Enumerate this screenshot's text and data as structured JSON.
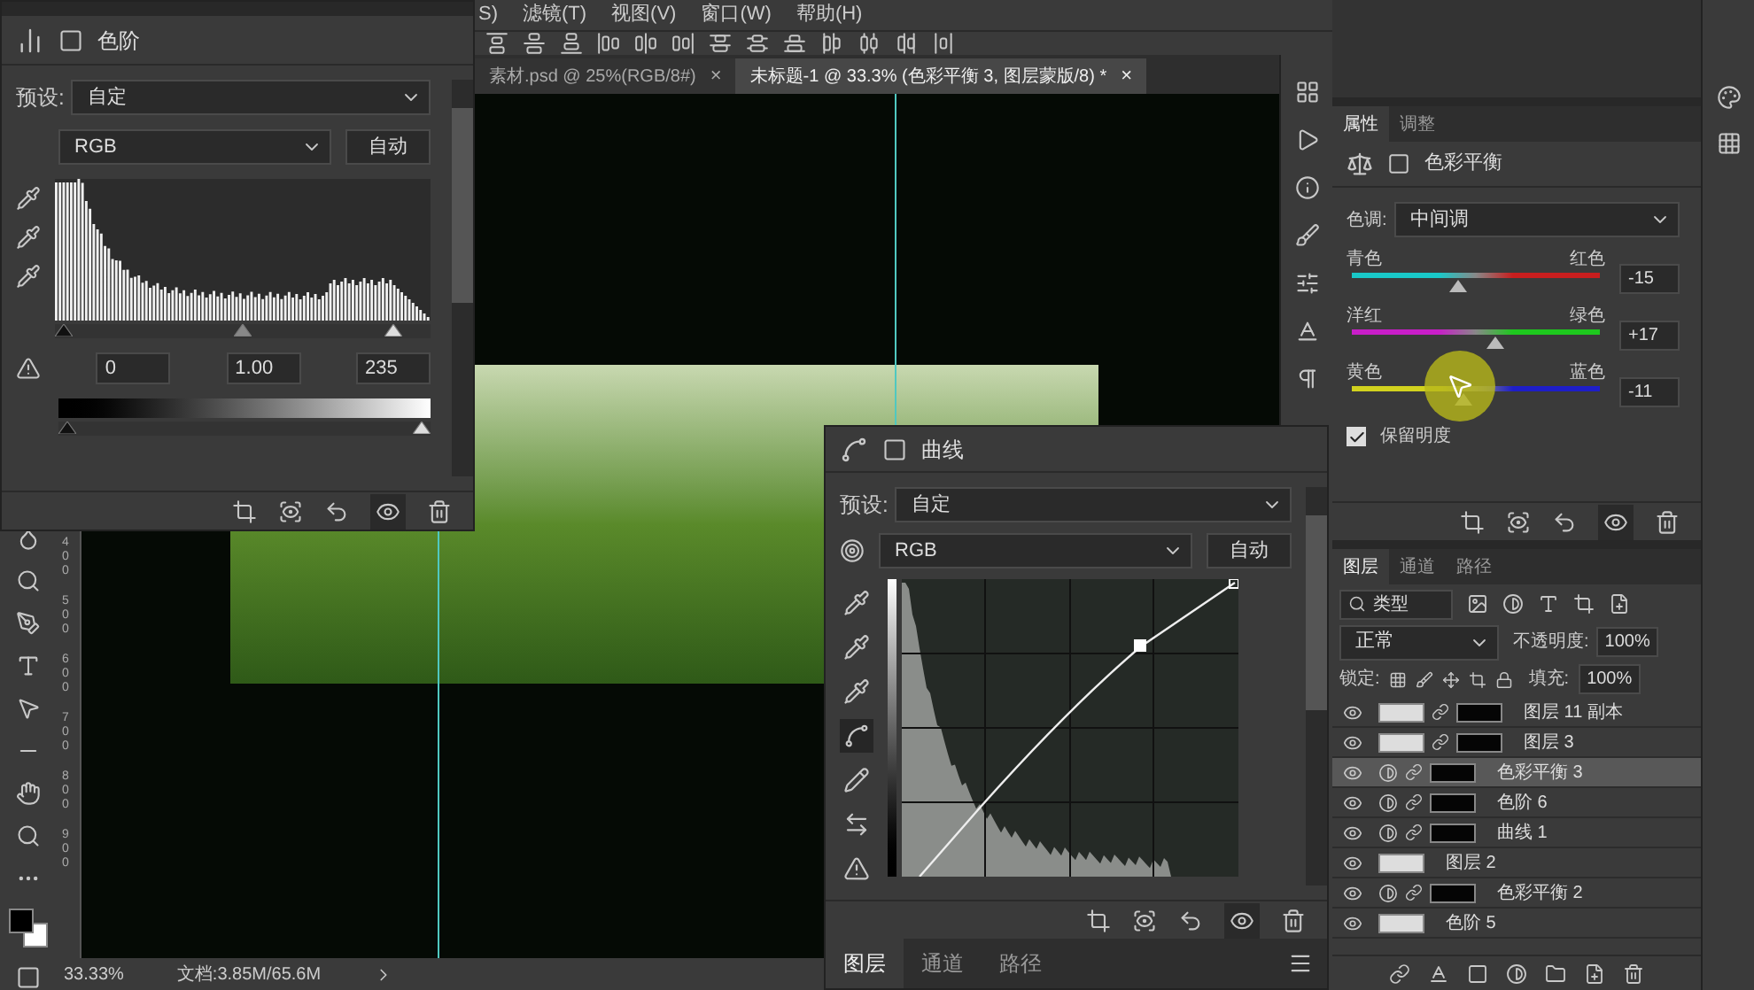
{
  "menu_bar": {
    "items": [
      "S)",
      "滤镜(T)",
      "视图(V)",
      "窗口(W)",
      "帮助(H)"
    ]
  },
  "document_tabs": [
    {
      "label": "素材.psd @ 25%(RGB/8#)",
      "close": "×",
      "selected": false
    },
    {
      "label": "未标题-1 @ 33.3% (色彩平衡 3, 图层蒙版/8) *",
      "close": "×",
      "selected": true
    }
  ],
  "levels_panel": {
    "title": "色阶",
    "preset_label": "预设:",
    "preset": "自定",
    "channel": "RGB",
    "auto_button": "自动",
    "input_sliders": [
      {
        "level": 0
      },
      {
        "level": 0.5
      },
      {
        "level": 0.92
      }
    ],
    "input_values": [
      "0",
      "1.00",
      "235"
    ],
    "output_sliders": [
      {
        "level": 0
      },
      {
        "level": 1
      }
    ]
  },
  "ruler_labels": [
    "400",
    "500",
    "600",
    "700",
    "800",
    "900"
  ],
  "status_bar": {
    "zoom": "33.33%",
    "doc_info": "文档:3.85M/65.6M"
  },
  "curves_panel": {
    "title": "曲线",
    "preset_label": "预设:",
    "preset": "自定",
    "channel": "RGB",
    "auto_button": "自动",
    "tools": [
      {
        "kind": "dropper",
        "selected": false
      },
      {
        "kind": "dropper",
        "selected": false
      },
      {
        "kind": "dropper",
        "selected": false
      },
      {
        "kind": "curve",
        "selected": true
      },
      {
        "kind": "pencil",
        "selected": false
      },
      {
        "kind": "smooth",
        "selected": false
      },
      {
        "kind": "warning",
        "selected": false
      }
    ],
    "bottom_tabs": [
      {
        "label": "图层",
        "selected": true
      },
      {
        "label": "通道",
        "selected": false
      },
      {
        "label": "路径",
        "selected": false
      }
    ]
  },
  "properties_panel": {
    "tabs": [
      {
        "label": "属性",
        "selected": true
      },
      {
        "label": "调整",
        "selected": false
      }
    ],
    "title": "色彩平衡",
    "tone_label": "色调:",
    "tone": "中间调",
    "sliders": [
      {
        "ends": [
          {
            "label": "青色",
            "color": "#19c8c8"
          },
          {
            "label": "红色",
            "color": "#c81e1e"
          }
        ],
        "level": 0.425,
        "reading": "-15"
      },
      {
        "ends": [
          {
            "label": "洋红",
            "color": "#c81ec8"
          },
          {
            "label": "绿色",
            "color": "#1ec81e"
          }
        ],
        "level": 0.585,
        "reading": "+17"
      },
      {
        "ends": [
          {
            "label": "黄色",
            "color": "#d2d21e"
          },
          {
            "label": "蓝色",
            "color": "#1e1ec8"
          }
        ],
        "level": 0.445,
        "reading": "-11"
      }
    ],
    "preserve_luminosity": {
      "label": "保留明度",
      "checked": true
    }
  },
  "layers_panel": {
    "tabs": [
      {
        "label": "图层",
        "selected": true
      },
      {
        "label": "通道",
        "selected": false
      },
      {
        "label": "路径",
        "selected": false
      }
    ],
    "filter": "类型",
    "blend_mode": "正常",
    "opacity_label": "不透明度:",
    "opacity": "100%",
    "lock_label": "锁定:",
    "fill_label": "填充:",
    "fill": "100%",
    "layers": [
      {
        "name": "图层 11 副本",
        "kind": "masked",
        "visible": true,
        "selected": false
      },
      {
        "name": "图层 3",
        "kind": "masked",
        "visible": true,
        "selected": false
      },
      {
        "name": "色彩平衡 3",
        "kind": "adjustment",
        "visible": true,
        "selected": true
      },
      {
        "name": "色阶 6",
        "kind": "adjustment",
        "visible": true,
        "selected": false
      },
      {
        "name": "曲线 1",
        "kind": "adjustment",
        "visible": true,
        "selected": false
      },
      {
        "name": "图层 2",
        "kind": "pixel",
        "visible": true,
        "selected": false
      },
      {
        "name": "色彩平衡 2",
        "kind": "adjustment",
        "visible": true,
        "selected": false
      },
      {
        "name": "色阶 5",
        "kind": "pixel",
        "visible": true,
        "selected": false
      }
    ]
  }
}
